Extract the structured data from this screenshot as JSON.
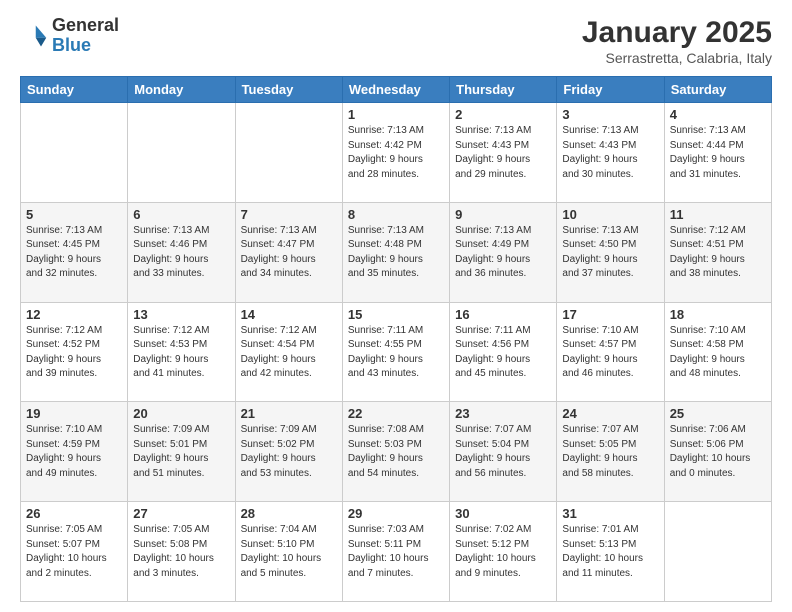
{
  "header": {
    "logo": {
      "line1": "General",
      "line2": "Blue"
    },
    "title": "January 2025",
    "subtitle": "Serrastretta, Calabria, Italy"
  },
  "weekdays": [
    "Sunday",
    "Monday",
    "Tuesday",
    "Wednesday",
    "Thursday",
    "Friday",
    "Saturday"
  ],
  "weeks": [
    [
      {
        "day": "",
        "info": ""
      },
      {
        "day": "",
        "info": ""
      },
      {
        "day": "",
        "info": ""
      },
      {
        "day": "1",
        "info": "Sunrise: 7:13 AM\nSunset: 4:42 PM\nDaylight: 9 hours\nand 28 minutes."
      },
      {
        "day": "2",
        "info": "Sunrise: 7:13 AM\nSunset: 4:43 PM\nDaylight: 9 hours\nand 29 minutes."
      },
      {
        "day": "3",
        "info": "Sunrise: 7:13 AM\nSunset: 4:43 PM\nDaylight: 9 hours\nand 30 minutes."
      },
      {
        "day": "4",
        "info": "Sunrise: 7:13 AM\nSunset: 4:44 PM\nDaylight: 9 hours\nand 31 minutes."
      }
    ],
    [
      {
        "day": "5",
        "info": "Sunrise: 7:13 AM\nSunset: 4:45 PM\nDaylight: 9 hours\nand 32 minutes."
      },
      {
        "day": "6",
        "info": "Sunrise: 7:13 AM\nSunset: 4:46 PM\nDaylight: 9 hours\nand 33 minutes."
      },
      {
        "day": "7",
        "info": "Sunrise: 7:13 AM\nSunset: 4:47 PM\nDaylight: 9 hours\nand 34 minutes."
      },
      {
        "day": "8",
        "info": "Sunrise: 7:13 AM\nSunset: 4:48 PM\nDaylight: 9 hours\nand 35 minutes."
      },
      {
        "day": "9",
        "info": "Sunrise: 7:13 AM\nSunset: 4:49 PM\nDaylight: 9 hours\nand 36 minutes."
      },
      {
        "day": "10",
        "info": "Sunrise: 7:13 AM\nSunset: 4:50 PM\nDaylight: 9 hours\nand 37 minutes."
      },
      {
        "day": "11",
        "info": "Sunrise: 7:12 AM\nSunset: 4:51 PM\nDaylight: 9 hours\nand 38 minutes."
      }
    ],
    [
      {
        "day": "12",
        "info": "Sunrise: 7:12 AM\nSunset: 4:52 PM\nDaylight: 9 hours\nand 39 minutes."
      },
      {
        "day": "13",
        "info": "Sunrise: 7:12 AM\nSunset: 4:53 PM\nDaylight: 9 hours\nand 41 minutes."
      },
      {
        "day": "14",
        "info": "Sunrise: 7:12 AM\nSunset: 4:54 PM\nDaylight: 9 hours\nand 42 minutes."
      },
      {
        "day": "15",
        "info": "Sunrise: 7:11 AM\nSunset: 4:55 PM\nDaylight: 9 hours\nand 43 minutes."
      },
      {
        "day": "16",
        "info": "Sunrise: 7:11 AM\nSunset: 4:56 PM\nDaylight: 9 hours\nand 45 minutes."
      },
      {
        "day": "17",
        "info": "Sunrise: 7:10 AM\nSunset: 4:57 PM\nDaylight: 9 hours\nand 46 minutes."
      },
      {
        "day": "18",
        "info": "Sunrise: 7:10 AM\nSunset: 4:58 PM\nDaylight: 9 hours\nand 48 minutes."
      }
    ],
    [
      {
        "day": "19",
        "info": "Sunrise: 7:10 AM\nSunset: 4:59 PM\nDaylight: 9 hours\nand 49 minutes."
      },
      {
        "day": "20",
        "info": "Sunrise: 7:09 AM\nSunset: 5:01 PM\nDaylight: 9 hours\nand 51 minutes."
      },
      {
        "day": "21",
        "info": "Sunrise: 7:09 AM\nSunset: 5:02 PM\nDaylight: 9 hours\nand 53 minutes."
      },
      {
        "day": "22",
        "info": "Sunrise: 7:08 AM\nSunset: 5:03 PM\nDaylight: 9 hours\nand 54 minutes."
      },
      {
        "day": "23",
        "info": "Sunrise: 7:07 AM\nSunset: 5:04 PM\nDaylight: 9 hours\nand 56 minutes."
      },
      {
        "day": "24",
        "info": "Sunrise: 7:07 AM\nSunset: 5:05 PM\nDaylight: 9 hours\nand 58 minutes."
      },
      {
        "day": "25",
        "info": "Sunrise: 7:06 AM\nSunset: 5:06 PM\nDaylight: 10 hours\nand 0 minutes."
      }
    ],
    [
      {
        "day": "26",
        "info": "Sunrise: 7:05 AM\nSunset: 5:07 PM\nDaylight: 10 hours\nand 2 minutes."
      },
      {
        "day": "27",
        "info": "Sunrise: 7:05 AM\nSunset: 5:08 PM\nDaylight: 10 hours\nand 3 minutes."
      },
      {
        "day": "28",
        "info": "Sunrise: 7:04 AM\nSunset: 5:10 PM\nDaylight: 10 hours\nand 5 minutes."
      },
      {
        "day": "29",
        "info": "Sunrise: 7:03 AM\nSunset: 5:11 PM\nDaylight: 10 hours\nand 7 minutes."
      },
      {
        "day": "30",
        "info": "Sunrise: 7:02 AM\nSunset: 5:12 PM\nDaylight: 10 hours\nand 9 minutes."
      },
      {
        "day": "31",
        "info": "Sunrise: 7:01 AM\nSunset: 5:13 PM\nDaylight: 10 hours\nand 11 minutes."
      },
      {
        "day": "",
        "info": ""
      }
    ]
  ]
}
